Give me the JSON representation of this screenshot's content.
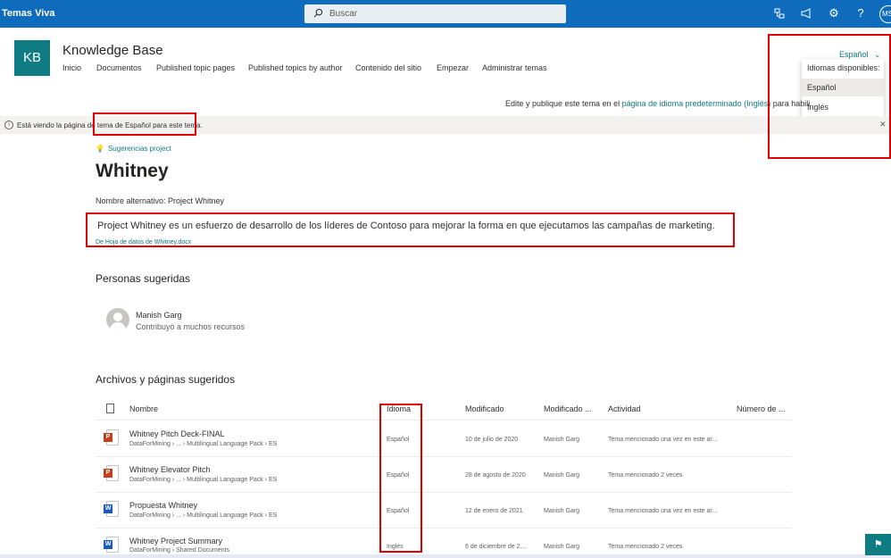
{
  "suite": {
    "app_title": "Temas Viva",
    "search_placeholder": "Buscar",
    "avatar_initials": "MS"
  },
  "site": {
    "logo": "KB",
    "title": "Knowledge Base",
    "nav": [
      "Inicio",
      "Documentos",
      "Published topic pages",
      "Published topics by author",
      "Contenido del sitio",
      "Empezar",
      "Administrar temas"
    ]
  },
  "language": {
    "current": "Español",
    "menu_header": "Idiomas disponibles:",
    "options": [
      "Español",
      "Inglés"
    ],
    "selected": "Español"
  },
  "edit_notice": {
    "prefix": "Edite y publique este tema en el ",
    "link": "página de idioma predeterminado (Inglés)",
    "suffix": " para habili"
  },
  "info_bar": {
    "text": "Está viendo la página de tema de Español para este tema."
  },
  "topic": {
    "suggestion_label": "Sugerencias project",
    "title": "Whitney",
    "alt_name": "Nombre alternativo: Project Whitney",
    "description": "Project Whitney es un esfuerzo de desarrollo de los líderes de Contoso para mejorar la forma en que ejecutamos las campañas de marketing.",
    "source": "De Hoja de datos de Whitney.docx"
  },
  "people": {
    "heading": "Personas sugeridas",
    "items": [
      {
        "name": "Manish Garg",
        "detail": "Contribuyó a muchos recursos"
      }
    ]
  },
  "files": {
    "heading": "Archivos y páginas sugeridos",
    "columns": [
      "Nombre",
      "Idioma",
      "Modificado",
      "Modificado ...",
      "Actividad",
      "Número de ..."
    ],
    "rows": [
      {
        "icon": "powerpoint-icon",
        "type": "P",
        "name": "Whitney Pitch Deck-FINAL",
        "path": "DataForMining › ... › Multilingual Language Pack › ES",
        "language": "Español",
        "modified": "10 de julio de 2020",
        "modified_by": "Manish Garg",
        "activity": "Tema mencionado una vez en este ar..."
      },
      {
        "icon": "powerpoint-icon",
        "type": "P",
        "name": "Whitney Elevator Pitch",
        "path": "DataForMining › ... › Multilingual Language Pack › ES",
        "language": "Español",
        "modified": "28 de agosto de 2020",
        "modified_by": "Manish Garg",
        "activity": "Tema mencionado 2 veces"
      },
      {
        "icon": "word-icon",
        "type": "W",
        "name": "Propuesta Whitney",
        "path": "DataForMining › ... › Multilingual Language Pack › ES",
        "language": "Español",
        "modified": "12 de enero de 2021",
        "modified_by": "Manish Garg",
        "activity": "Tema mencionado una vez en este ar..."
      },
      {
        "icon": "word-icon",
        "type": "W",
        "name": "Whitney Project Summary",
        "path": "DataForMining › Shared Documents",
        "language": "Inglés",
        "modified": "6 de diciembre de 2...",
        "modified_by": "Manish Garg",
        "activity": "Tema mencionado 2 veces"
      }
    ]
  },
  "colors": {
    "suite_bar": "#0f6cbd",
    "accent": "#0f7b83",
    "highlight": "#e00000"
  }
}
